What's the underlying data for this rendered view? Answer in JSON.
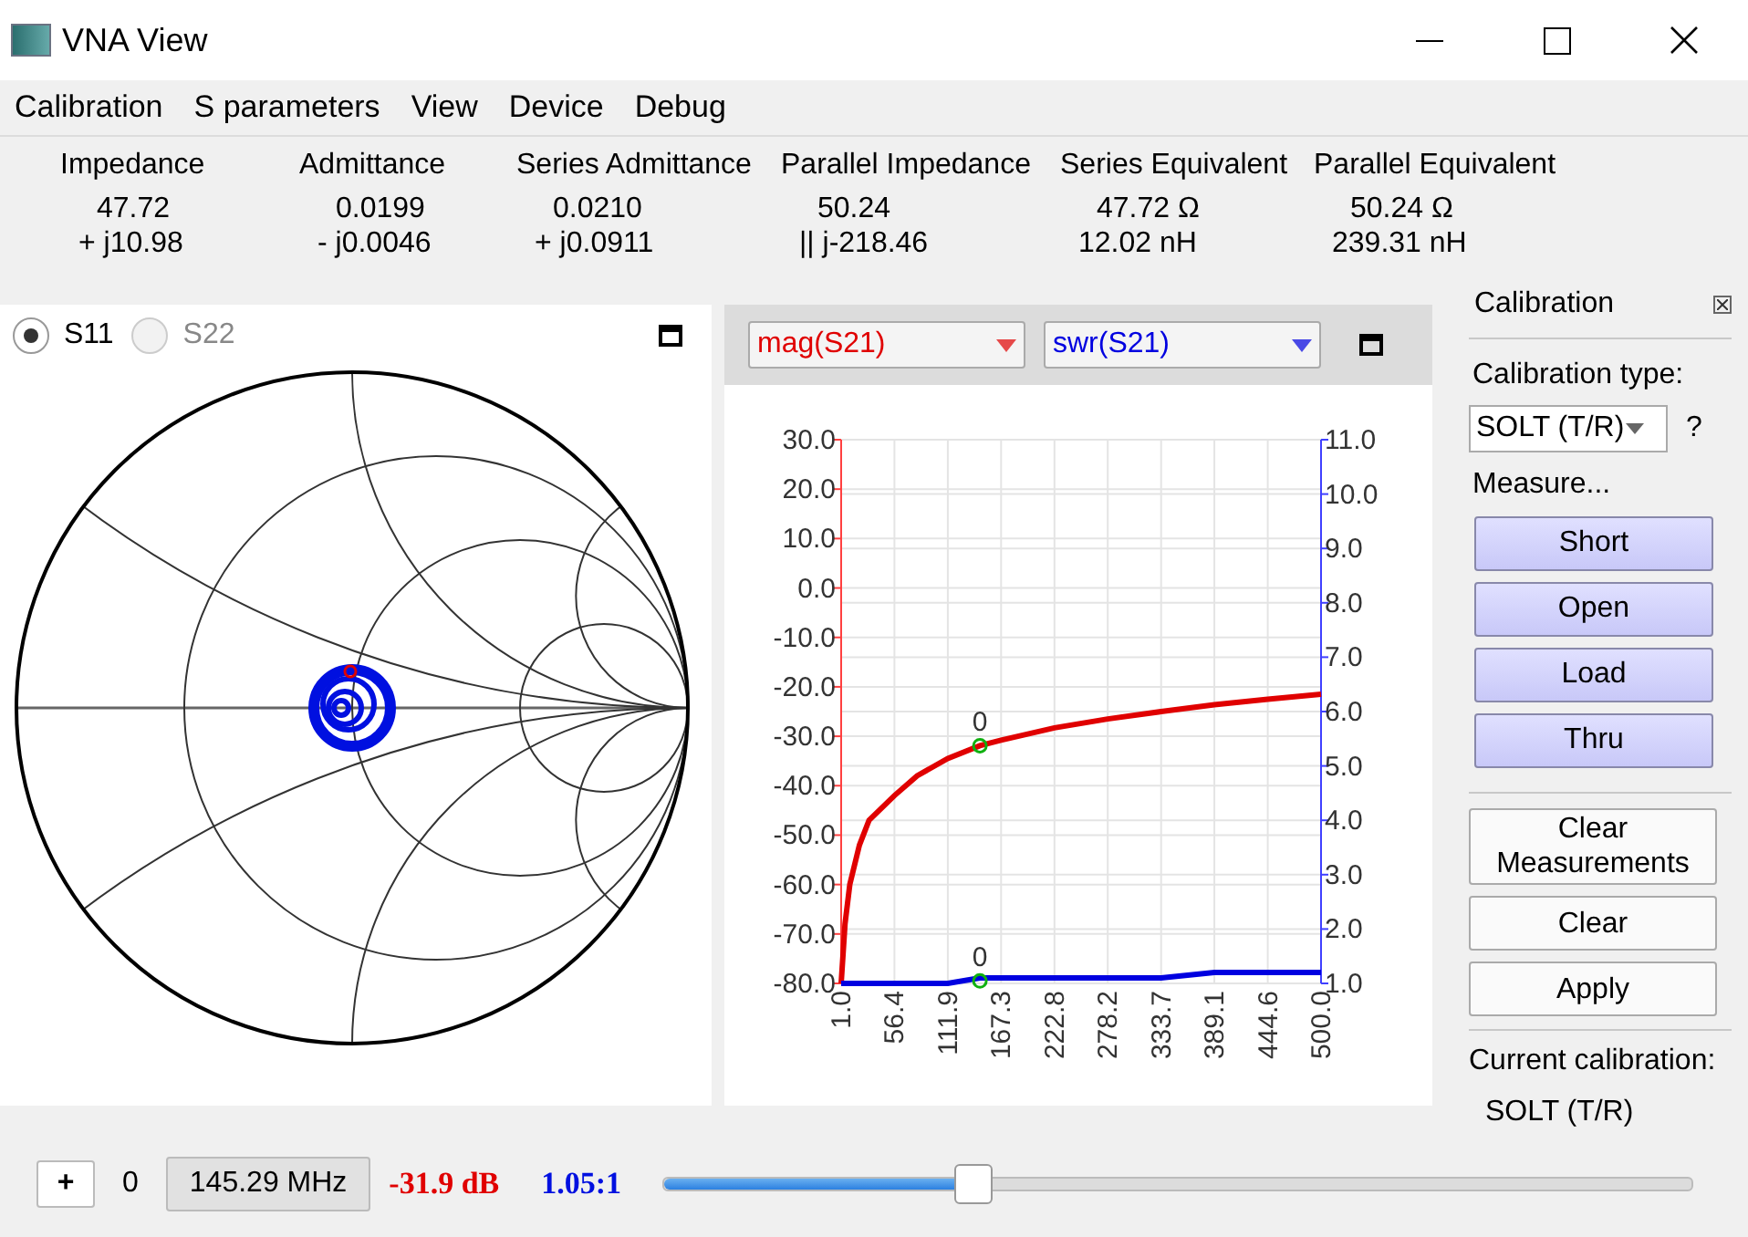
{
  "window": {
    "title": "VNA View"
  },
  "menu": [
    "Calibration",
    "S parameters",
    "View",
    "Device",
    "Debug"
  ],
  "measurements": [
    {
      "header": "Impedance",
      "line_1": "47.72",
      "line_2": "+ j10.98"
    },
    {
      "header": "Admittance",
      "line_1": "0.0199",
      "line_2": "- j0.0046"
    },
    {
      "header": "Series Admittance",
      "line_1": "0.0210",
      "line_2": "+ j0.0911"
    },
    {
      "header": "Parallel Impedance",
      "line_1": "50.24",
      "line_2": "|| j-218.46"
    },
    {
      "header": "Series Equivalent",
      "line_1": "47.72 Ω",
      "line_2": "12.02 nH"
    },
    {
      "header": "Parallel Equivalent",
      "line_1": "50.24 Ω",
      "line_2": "239.31 nH"
    }
  ],
  "smith": {
    "ports": [
      {
        "label": "S11",
        "selected": true,
        "disabled": false
      },
      {
        "label": "S22",
        "selected": false,
        "disabled": true
      }
    ]
  },
  "plot": {
    "chart_data": {
      "type": "line",
      "x": [
        1,
        5,
        10,
        20,
        30,
        56.4,
        80,
        111.9,
        145.29,
        167.3,
        222.8,
        278.2,
        333.7,
        389.1,
        444.6,
        500
      ],
      "series": [
        {
          "name": "mag(S21)",
          "color": "#e00000",
          "values": [
            -80,
            -68,
            -60,
            -52,
            -47,
            -42,
            -38,
            -34.5,
            -31.9,
            -30.8,
            -28.3,
            -26.5,
            -25,
            -23.6,
            -22.5,
            -21.5
          ]
        },
        {
          "name": "swr(S21)",
          "color": "#0000e0",
          "axis": "y2",
          "values": [
            1.0,
            1.0,
            1.0,
            1.0,
            1.0,
            1.0,
            1.0,
            1.0,
            1.1,
            1.1,
            1.1,
            1.1,
            1.1,
            1.2,
            1.2,
            1.2
          ]
        }
      ],
      "grid": true,
      "xlim": [
        1,
        500
      ],
      "ylim": [
        -80,
        30
      ],
      "y2lim": [
        1,
        11
      ],
      "xticks": [
        {
          "value": 1,
          "label": "1.0"
        },
        {
          "value": 56.4,
          "label": "56.4"
        },
        {
          "value": 111.9,
          "label": "111.9"
        },
        {
          "value": 167.3,
          "label": "167.3"
        },
        {
          "value": 222.8,
          "label": "222.8"
        },
        {
          "value": 278.2,
          "label": "278.2"
        },
        {
          "value": 333.7,
          "label": "333.7"
        },
        {
          "value": 389.1,
          "label": "389.1"
        },
        {
          "value": 444.6,
          "label": "444.6"
        },
        {
          "value": 500,
          "label": "500.0"
        }
      ],
      "yticks": [
        {
          "value": 30,
          "label": "30.0"
        },
        {
          "value": 20,
          "label": "20.0"
        },
        {
          "value": 10,
          "label": "10.0"
        },
        {
          "value": 0,
          "label": "0.0"
        },
        {
          "value": -10,
          "label": "-10.0"
        },
        {
          "value": -20,
          "label": "-20.0"
        },
        {
          "value": -30,
          "label": "-30.0"
        },
        {
          "value": -40,
          "label": "-40.0"
        },
        {
          "value": -50,
          "label": "-50.0"
        },
        {
          "value": -60,
          "label": "-60.0"
        },
        {
          "value": -70,
          "label": "-70.0"
        },
        {
          "value": -80,
          "label": "-80.0"
        }
      ],
      "y2ticks": [
        {
          "value": 11,
          "label": "11.0"
        },
        {
          "value": 10,
          "label": "10.0"
        },
        {
          "value": 9,
          "label": "9.0"
        },
        {
          "value": 8,
          "label": "8.0"
        },
        {
          "value": 7,
          "label": "7.0"
        },
        {
          "value": 6,
          "label": "6.0"
        },
        {
          "value": 5,
          "label": "5.0"
        },
        {
          "value": 4,
          "label": "4.0"
        },
        {
          "value": 3,
          "label": "3.0"
        },
        {
          "value": 2,
          "label": "2.0"
        },
        {
          "value": 1,
          "label": "1.0"
        }
      ],
      "annotations": [
        {
          "x": 145.29,
          "y": -31.9,
          "text": "0"
        },
        {
          "x": 145.29,
          "y": -79.5,
          "text": "0"
        }
      ]
    }
  },
  "calibration": {
    "title": "Calibration",
    "type_label": "Calibration type:",
    "type_value": "SOLT (T/R)",
    "help": "?",
    "measure_label": "Measure...",
    "measure_buttons": [
      "Short",
      "Open",
      "Load",
      "Thru"
    ],
    "action_buttons": [
      "Clear Measurements",
      "Clear",
      "Apply"
    ],
    "current_label": "Current calibration:",
    "current_value": "SOLT (T/R)"
  },
  "marker_bar": {
    "add": "+",
    "index": "0",
    "frequency": "145.29 MHz",
    "magnitude": "-31.9 dB",
    "swr": "1.05:1",
    "level": 0.3
  }
}
